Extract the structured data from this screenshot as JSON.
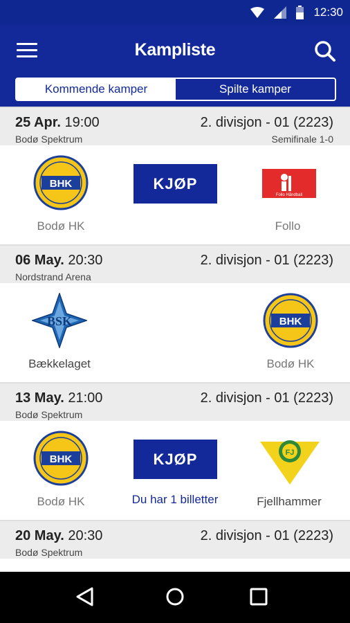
{
  "status_bar": {
    "time": "12:30",
    "icons": [
      "wifi-icon",
      "signal-icon",
      "battery-icon"
    ]
  },
  "app_bar": {
    "title": "Kampliste",
    "menu_icon": "hamburger-menu-icon",
    "search_icon": "search-icon"
  },
  "tabs": [
    {
      "label": "Kommende kamper",
      "active": true
    },
    {
      "label": "Spilte kamper",
      "active": false
    }
  ],
  "matches": [
    {
      "date": "25 Apr.",
      "time": "19:00",
      "venue": "Bodø Spektrum",
      "league": "2. divisjon - 01 (2223)",
      "round": "Semifinale 1-0",
      "home": {
        "name": "Bodø HK",
        "logo_text": "BHK"
      },
      "away": {
        "name": "Follo",
        "logo_text": "Follo Håndball"
      },
      "buy_label": "KJØP",
      "ticket_note": ""
    },
    {
      "date": "06 May.",
      "time": "20:30",
      "venue": "Nordstrand Arena",
      "league": "2. divisjon - 01 (2223)",
      "round": "",
      "home": {
        "name": "Bækkelaget",
        "logo_text": "BSK"
      },
      "away": {
        "name": "Bodø HK",
        "logo_text": "BHK"
      },
      "buy_label": "",
      "ticket_note": ""
    },
    {
      "date": "13 May.",
      "time": "21:00",
      "venue": "Bodø Spektrum",
      "league": "2. divisjon - 01 (2223)",
      "round": "",
      "home": {
        "name": "Bodø HK",
        "logo_text": "BHK"
      },
      "away": {
        "name": "Fjellhammer",
        "logo_text": "FJ"
      },
      "buy_label": "KJØP",
      "ticket_note": "Du har 1 billetter"
    },
    {
      "date": "20 May.",
      "time": "20:30",
      "venue": "Bodø Spektrum",
      "league": "2. divisjon - 01 (2223)",
      "round": ""
    }
  ],
  "colors": {
    "primary": "#13299a",
    "status_bar": "#0f2891",
    "header_bg": "#ececec",
    "bhk_yellow": "#f5c518",
    "bhk_blue": "#1b3f9a",
    "follo_red": "#e32b2b",
    "fjell_yellow": "#f2d21b",
    "fjell_green": "#2e8a3a"
  },
  "nav": {
    "back_icon": "back-triangle-icon",
    "home_icon": "home-circle-icon",
    "recents_icon": "recents-square-icon"
  }
}
